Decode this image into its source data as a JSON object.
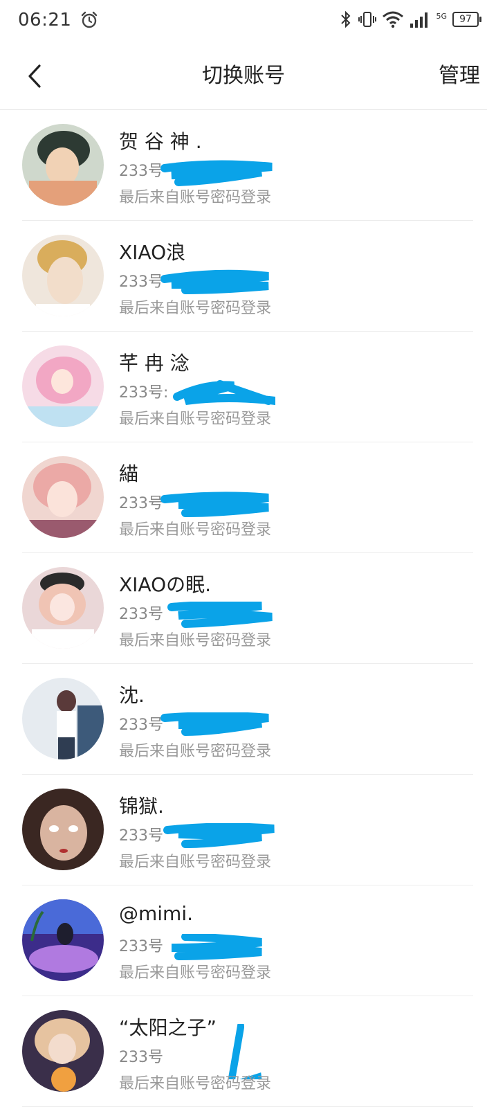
{
  "status_bar": {
    "time": "06:21",
    "network": "5G",
    "battery": "97",
    "icons": [
      "alarm-icon",
      "bluetooth-icon",
      "vibrate-icon",
      "wifi-icon",
      "signal-icon",
      "battery-icon"
    ]
  },
  "header": {
    "title": "切换账号",
    "manage_label": "管理",
    "back_icon": "chevron-left-icon"
  },
  "accounts": [
    {
      "name": "贺 谷 神 .",
      "id_label": "233号",
      "note": "最后来自账号密码登录",
      "avatar_color": "#7d8f7a"
    },
    {
      "name": "XIAO浪",
      "id_label": "233号",
      "note": "最后来自账号密码登录",
      "avatar_color": "#d9b27a"
    },
    {
      "name": "芊 冉 淰",
      "id_label": "233号: ",
      "note": "最后来自账号密码登录",
      "avatar_color": "#f2a7c4"
    },
    {
      "name": "緢",
      "id_label": "233号",
      "note": "最后来自账号密码登录",
      "avatar_color": "#e8a7a8"
    },
    {
      "name": "XIAOの眠.",
      "id_label": "233号",
      "note": "最后来自账号密码登录",
      "avatar_color": "#e3c6c8"
    },
    {
      "name": "沈.",
      "id_label": "233号",
      "note": "最后来自账号密码登录",
      "avatar_color": "#b9c3cf"
    },
    {
      "name": "锦獄.",
      "id_label": "233号",
      "note": "最后来自账号密码登录",
      "avatar_color": "#5a3a2e"
    },
    {
      "name": "@mimi.",
      "id_label": "233号",
      "note": "最后来自账号密码登录",
      "avatar_color": "#6a4cc9"
    },
    {
      "name": "“太阳之子”",
      "id_label": "233号",
      "note": "最后来自账号密码登录",
      "avatar_color": "#c9a06a"
    }
  ],
  "colors": {
    "redaction": "#0aa3e8",
    "divider": "#ececec",
    "secondary_text": "#9a9a9a"
  }
}
